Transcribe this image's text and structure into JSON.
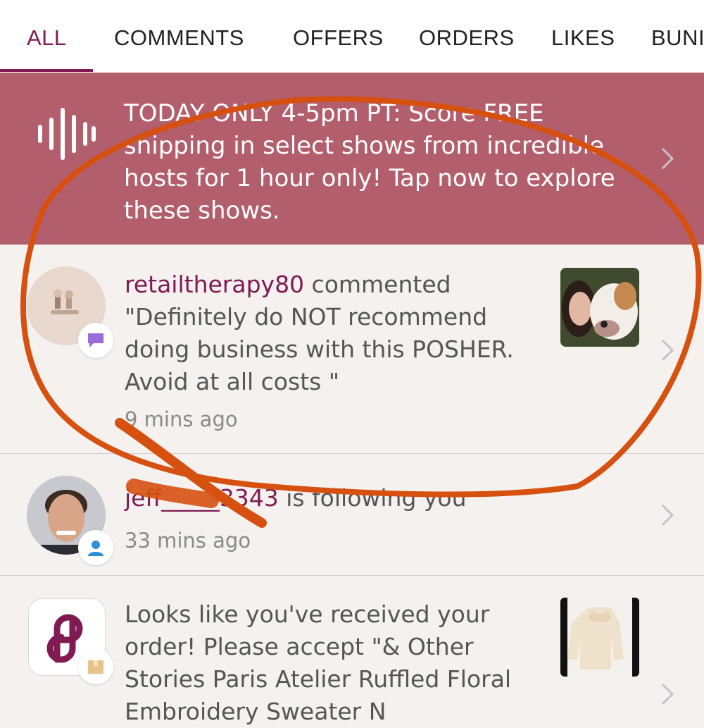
{
  "tabs": [
    {
      "label": "ALL"
    },
    {
      "label": "COMMENTS"
    },
    {
      "label": "OFFERS"
    },
    {
      "label": "ORDERS"
    },
    {
      "label": "LIKES"
    },
    {
      "label": "BUNI"
    }
  ],
  "banner": {
    "text": "TODAY ONLY 4-5pm PT: Score FREE shipping in select shows from incredible hosts for 1 hour only! Tap now to explore these shows."
  },
  "notifications": [
    {
      "username": "retailtherapy80",
      "action": " commented",
      "comment": "\"Definitely do NOT recommend doing business with this POSHER. Avoid at all costs \"",
      "time": "9 mins ago"
    },
    {
      "username": "jeff_____3343",
      "action": " is following you",
      "time": "33 mins ago"
    },
    {
      "message": "Looks like you've received your order! Please accept \"& Other Stories Paris Atelier Ruffled Floral Embroidery Sweater N"
    }
  ],
  "colors": {
    "accent": "#7f1a52",
    "banner": "#b35e6c",
    "annotation": "#d6500f"
  }
}
